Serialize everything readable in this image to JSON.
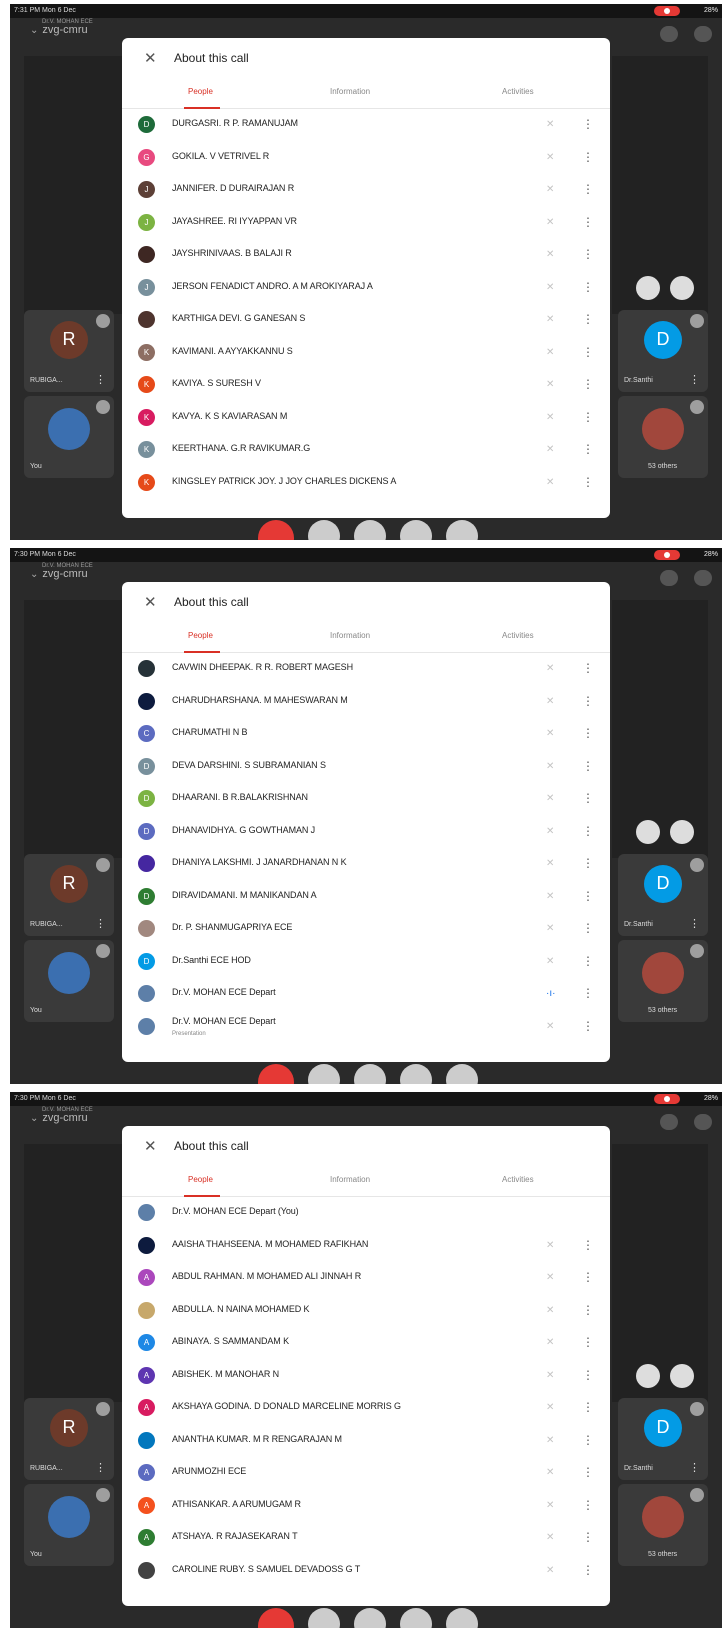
{
  "panels": [
    {
      "time": "7:31 PM  Mon 6 Dec",
      "battery": "28%",
      "meeting": "zvg-cmru",
      "host_small": "Dr.V. MOHAN ECE",
      "sheet_title": "About this call",
      "tabs": [
        "People",
        "Information",
        "Activities"
      ],
      "participants": [
        {
          "name": "DURGASRI. R P. RAMANUJAM",
          "initial": "D",
          "color": "#1e6b3a"
        },
        {
          "name": "GOKILA. V VETRIVEL R",
          "initial": "G",
          "color": "#e84a7f"
        },
        {
          "name": "JANNIFER. D DURAIRAJAN R",
          "initial": "J",
          "color": "#5d4037"
        },
        {
          "name": "JAYASHREE. RI IYYAPPAN VR",
          "initial": "J",
          "color": "#7cb342"
        },
        {
          "name": "JAYSHRINIVAAS. B BALAJI R",
          "initial": "",
          "color": "#3e2723"
        },
        {
          "name": "JERSON FENADICT ANDRO. A M AROKIYARAJ A",
          "initial": "J",
          "color": "#78909c"
        },
        {
          "name": "KARTHIGA DEVI. G GANESAN S",
          "initial": "",
          "color": "#4e342e"
        },
        {
          "name": "KAVIMANI. A AYYAKKANNU S",
          "initial": "K",
          "color": "#8d6e63"
        },
        {
          "name": "KAVIYA. S SURESH V",
          "initial": "K",
          "color": "#e64a19"
        },
        {
          "name": "KAVYA. K S KAVIARASAN M",
          "initial": "K",
          "color": "#d81b60"
        },
        {
          "name": "KEERTHANA. G.R RAVIKUMAR.G",
          "initial": "K",
          "color": "#78909c"
        },
        {
          "name": "KINGSLEY PATRICK JOY. J JOY CHARLES DICKENS A",
          "initial": "K",
          "color": "#e64a19"
        }
      ],
      "tile_labels": {
        "rubiga": "RUBIGA...",
        "you": "You",
        "santhi": "Dr.Santhi",
        "others": "53 others"
      }
    },
    {
      "time": "7:30 PM  Mon 6 Dec",
      "battery": "28%",
      "meeting": "zvg-cmru",
      "host_small": "Dr.V. MOHAN ECE",
      "sheet_title": "About this call",
      "tabs": [
        "People",
        "Information",
        "Activities"
      ],
      "participants": [
        {
          "name": "CAVWIN DHEEPAK. R R. ROBERT MAGESH",
          "initial": "",
          "color": "#263238"
        },
        {
          "name": "CHARUDHARSHANA. M MAHESWARAN M",
          "initial": "",
          "color": "#0d1b3e"
        },
        {
          "name": "CHARUMATHI N B",
          "initial": "C",
          "color": "#5c6bc0"
        },
        {
          "name": "DEVA DARSHINI. S SUBRAMANIAN S",
          "initial": "D",
          "color": "#78909c"
        },
        {
          "name": "DHAARANI. B R.BALAKRISHNAN",
          "initial": "D",
          "color": "#7cb342"
        },
        {
          "name": "DHANAVIDHYA. G GOWTHAMAN J",
          "initial": "D",
          "color": "#5c6bc0"
        },
        {
          "name": "DHANIYA LAKSHMI. J JANARDHANAN N K",
          "initial": "",
          "color": "#4527a0"
        },
        {
          "name": "DIRAVIDAMANI. M MANIKANDAN A",
          "initial": "D",
          "color": "#2e7d32"
        },
        {
          "name": "Dr. P. SHANMUGAPRIYA ECE",
          "initial": "",
          "color": "#a1887f"
        },
        {
          "name": "Dr.Santhi ECE HOD",
          "initial": "D",
          "color": "#039be5"
        },
        {
          "name": "Dr.V. MOHAN ECE Depart",
          "initial": "",
          "color": "#5d7fa8",
          "speaking": true
        },
        {
          "name": "Dr.V. MOHAN ECE Depart",
          "initial": "",
          "color": "#5d7fa8",
          "sub": "Presentation"
        }
      ],
      "tile_labels": {
        "rubiga": "RUBIGA...",
        "you": "You",
        "santhi": "Dr.Santhi",
        "others": "53 others"
      }
    },
    {
      "time": "7:30 PM  Mon 6 Dec",
      "battery": "28%",
      "meeting": "zvg-cmru",
      "host_small": "Dr.V. MOHAN ECE",
      "sheet_title": "About this call",
      "tabs": [
        "People",
        "Information",
        "Activities"
      ],
      "participants": [
        {
          "name": "Dr.V. MOHAN ECE Depart (You)",
          "initial": "",
          "color": "#5d7fa8",
          "nomic": true
        },
        {
          "name": "AAISHA THAHSEENA. M MOHAMED RAFIKHAN",
          "initial": "",
          "color": "#0d1b3e"
        },
        {
          "name": "ABDUL RAHMAN. M MOHAMED ALI JINNAH R",
          "initial": "A",
          "color": "#ab47bc"
        },
        {
          "name": "ABDULLA. N NAINA MOHAMED K",
          "initial": "",
          "color": "#c7a86b"
        },
        {
          "name": "ABINAYA. S SAMMANDAM K",
          "initial": "A",
          "color": "#1e88e5"
        },
        {
          "name": "ABISHEK. M MANOHAR N",
          "initial": "A",
          "color": "#5e35b1"
        },
        {
          "name": "AKSHAYA GODINA. D DONALD MARCELINE MORRIS G",
          "initial": "A",
          "color": "#d81b60"
        },
        {
          "name": "ANANTHA KUMAR. M R RENGARAJAN M",
          "initial": "",
          "color": "#0277bd"
        },
        {
          "name": "ARUNMOZHI ECE",
          "initial": "A",
          "color": "#5c6bc0"
        },
        {
          "name": "ATHISANKAR. A ARUMUGAM R",
          "initial": "A",
          "color": "#f4511e"
        },
        {
          "name": "ATSHAYA. R RAJASEKARAN T",
          "initial": "A",
          "color": "#2e7d32"
        },
        {
          "name": "CAROLINE RUBY. S SAMUEL DEVADOSS G T",
          "initial": "",
          "color": "#424242"
        }
      ],
      "tile_labels": {
        "rubiga": "RUBIGA...",
        "you": "You",
        "santhi": "Dr.Santhi",
        "others": "53 others"
      }
    }
  ]
}
